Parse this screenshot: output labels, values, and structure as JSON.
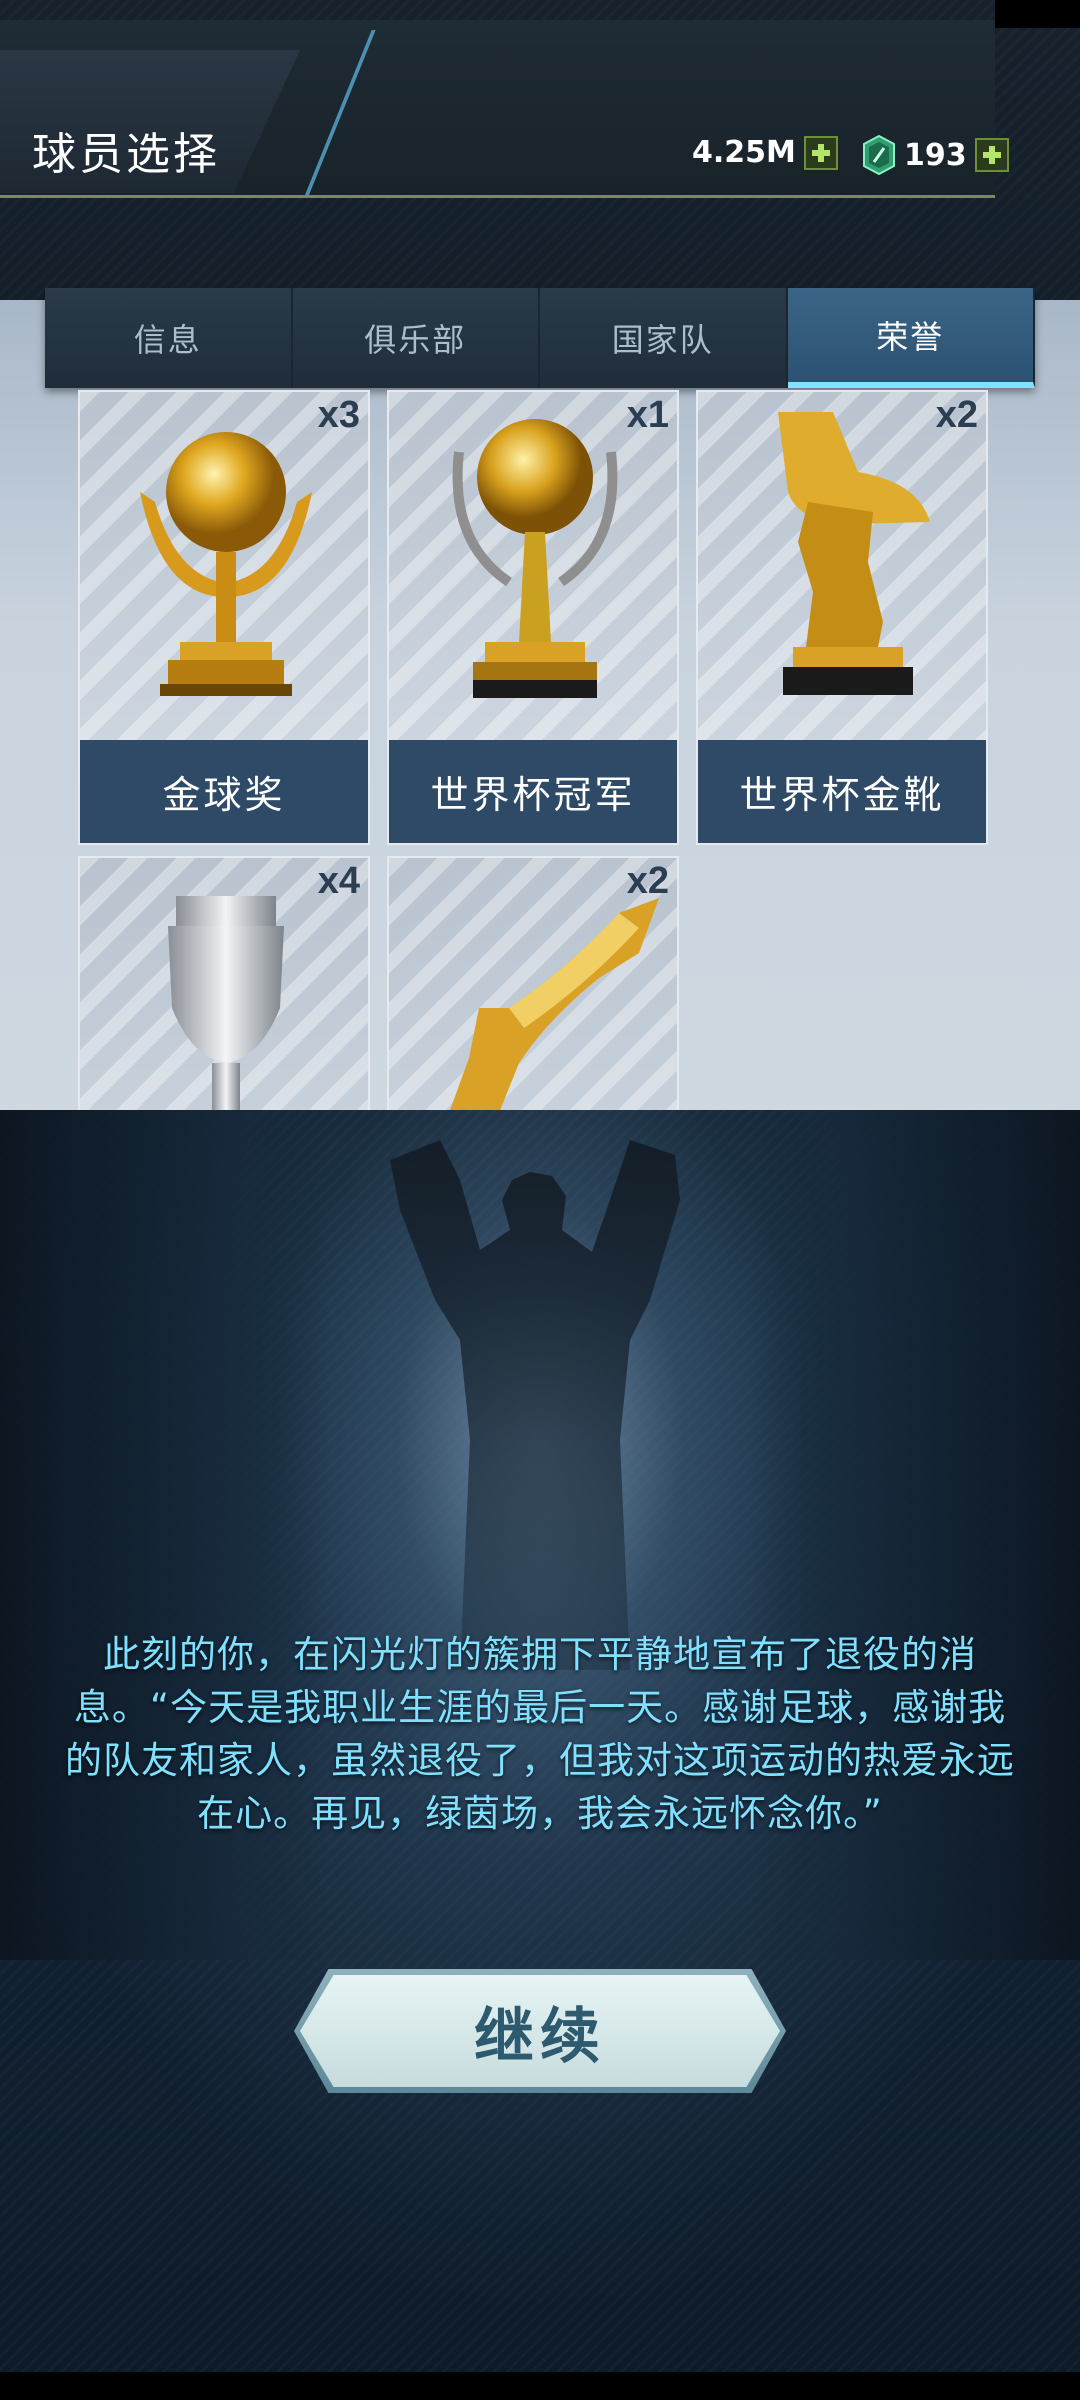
{
  "header": {
    "title": "球员选择",
    "coins": "4.25M",
    "gems": "193"
  },
  "tabs": [
    {
      "label": "信息",
      "active": false
    },
    {
      "label": "俱乐部",
      "active": false
    },
    {
      "label": "国家队",
      "active": false
    },
    {
      "label": "荣誉",
      "active": true
    }
  ],
  "honors": [
    {
      "name": "金球奖",
      "count": "x3",
      "icon": "golden-ball-trophy-icon"
    },
    {
      "name": "世界杯冠军",
      "count": "x1",
      "icon": "world-cup-trophy-icon"
    },
    {
      "name": "世界杯金靴",
      "count": "x2",
      "icon": "golden-boot-trophy-icon"
    },
    {
      "name": "",
      "count": "x4",
      "icon": "silver-cup-trophy-icon"
    },
    {
      "name": "",
      "count": "x2",
      "icon": "golden-boot-icon"
    }
  ],
  "story": "此刻的你，在闪光灯的簇拥下平静地宣布了退役的消息。“今天是我职业生涯的最后一天。感谢足球，感谢我的队友和家人，虽然退役了，但我对这项运动的热爱永远在心。再见，绿茵场，我会永远怀念你。”",
  "continue_label": "继续",
  "colors": {
    "accent": "#7de4ff",
    "story_text": "#7fe0ff",
    "card_label_bg": "#2e4a66"
  }
}
